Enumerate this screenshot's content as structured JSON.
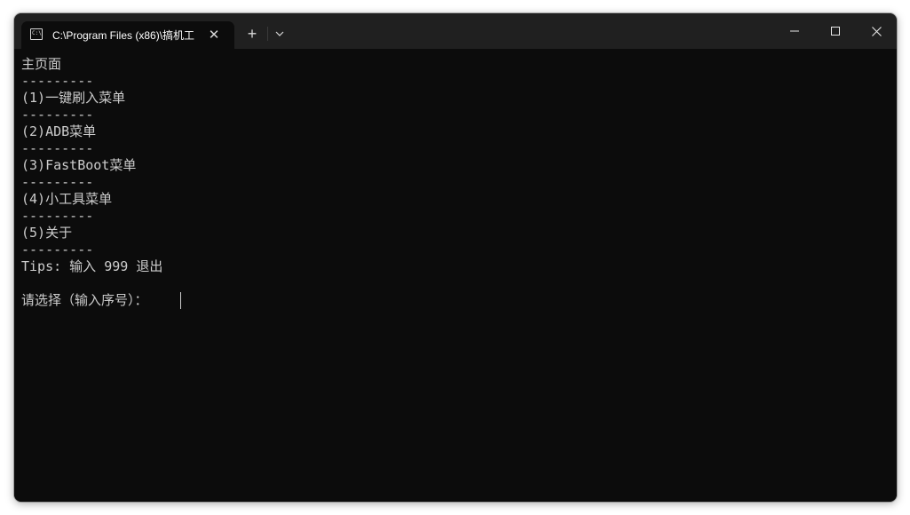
{
  "window": {
    "tab_title": "C:\\Program Files (x86)\\搞机工",
    "tab_icon": "command-prompt-icon",
    "tab_icon_text": "C:\\",
    "close_tab_glyph": "✕",
    "new_tab_glyph": "+"
  },
  "terminal": {
    "lines": [
      "主页面",
      "---------",
      "(1)一键刷入菜单",
      "---------",
      "(2)ADB菜单",
      "---------",
      "(3)FastBoot菜单",
      "---------",
      "(4)小工具菜单",
      "---------",
      "(5)关于",
      "---------",
      "Tips: 输入 999 退出",
      "",
      "请选择（输入序号）："
    ],
    "text_color": "#cccccc",
    "background_color": "#0c0c0c"
  }
}
